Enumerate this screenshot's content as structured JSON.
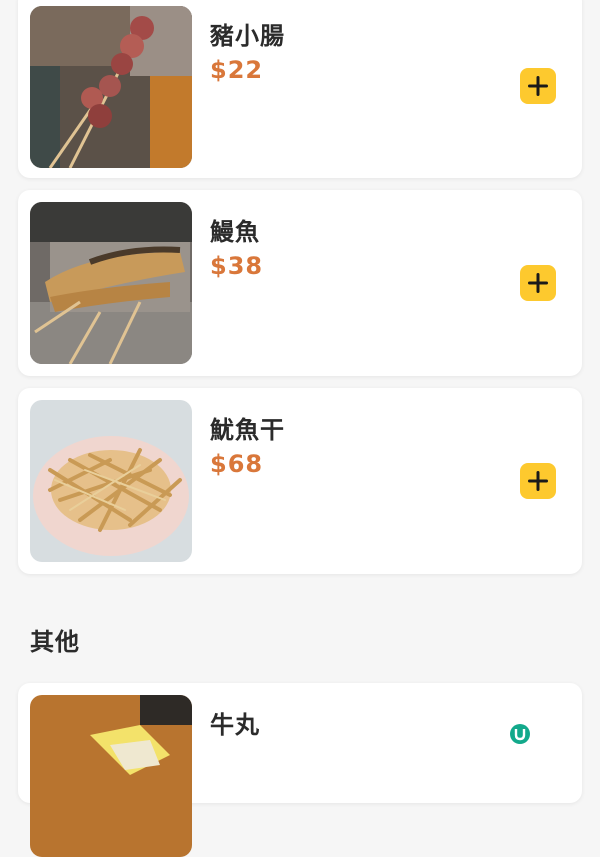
{
  "menu": {
    "items": [
      {
        "name": "豬小腸",
        "price": "$22",
        "image": "grilled-intestine-skewers"
      },
      {
        "name": "鰻魚",
        "price": "$38",
        "image": "grilled-eel-skewers"
      },
      {
        "name": "魷魚干",
        "price": "$68",
        "image": "dried-squid-strips"
      }
    ],
    "sections": [
      {
        "title": "其他",
        "items": [
          {
            "name": "牛丸",
            "image": "beef-balls"
          }
        ]
      }
    ]
  },
  "icons": {
    "add": "plus-icon",
    "watermark": "u-logo-icon"
  },
  "colors": {
    "accent": "#fdc92e",
    "price": "#d9773a",
    "background": "#f6f6f6",
    "card": "#ffffff",
    "text": "#2b2b2b",
    "watermark": "#13a98b"
  }
}
